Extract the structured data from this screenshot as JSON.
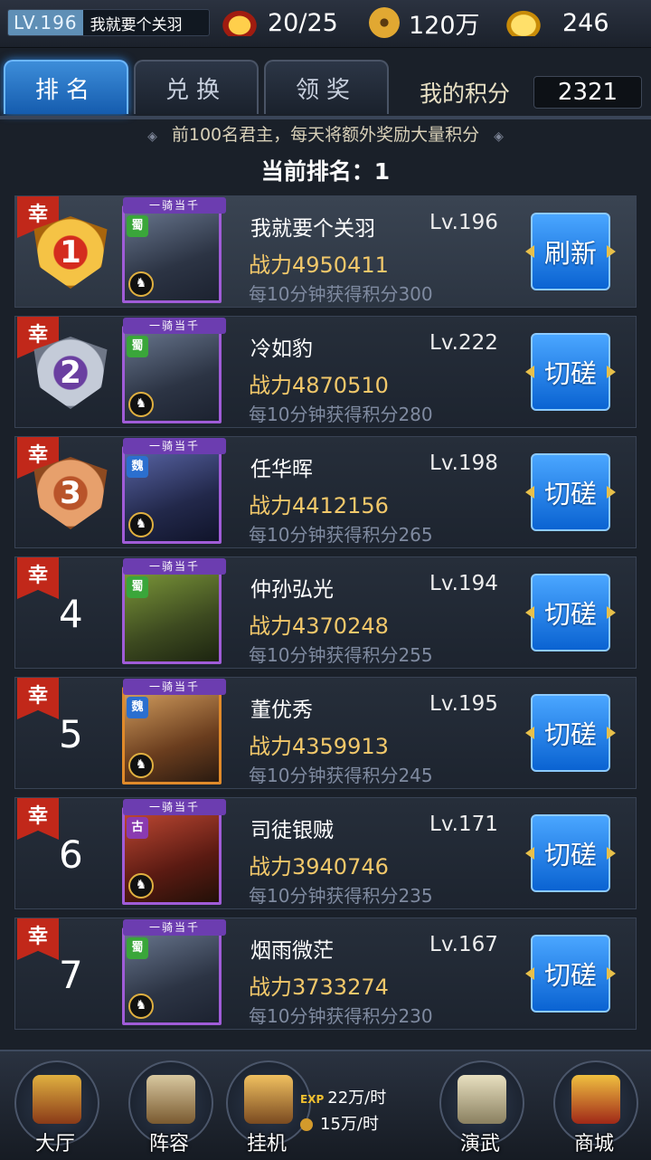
{
  "header": {
    "level_label": "LV.196",
    "player_name": "我就要个关羽",
    "stamina": "20/25",
    "copper": "120万",
    "gold": "246"
  },
  "tabs": [
    {
      "label": "排名",
      "active": true
    },
    {
      "label": "兑换",
      "active": false
    },
    {
      "label": "领奖",
      "active": false
    }
  ],
  "my_score": {
    "label": "我的积分",
    "value": "2321"
  },
  "notice": "前100名君主，每天将额外奖励大量积分",
  "current_rank": "当前排名：1",
  "rows": [
    {
      "rank": "1",
      "ribbon": "幸",
      "name": "我就要个关羽",
      "level": "Lv.196",
      "power": "战力4950411",
      "rate": "每10分钟获得积分300",
      "button": "刷新",
      "faction": "蜀",
      "tag": "一骑当千",
      "chess": "♞"
    },
    {
      "rank": "2",
      "ribbon": "幸",
      "name": "冷如豹",
      "level": "Lv.222",
      "power": "战力4870510",
      "rate": "每10分钟获得积分280",
      "button": "切磋",
      "faction": "蜀",
      "tag": "一骑当千",
      "chess": "♞"
    },
    {
      "rank": "3",
      "ribbon": "幸",
      "name": "任华晖",
      "level": "Lv.198",
      "power": "战力4412156",
      "rate": "每10分钟获得积分265",
      "button": "切磋",
      "faction": "魏",
      "tag": "一骑当千",
      "chess": "♞"
    },
    {
      "rank": "4",
      "ribbon": "幸",
      "name": "仲孙弘光",
      "level": "Lv.194",
      "power": "战力4370248",
      "rate": "每10分钟获得积分255",
      "button": "切磋",
      "faction": "蜀",
      "tag": "一骑当千",
      "chess": ""
    },
    {
      "rank": "5",
      "ribbon": "幸",
      "name": "董优秀",
      "level": "Lv.195",
      "power": "战力4359913",
      "rate": "每10分钟获得积分245",
      "button": "切磋",
      "faction": "魏",
      "tag": "一骑当千",
      "chess": "♞"
    },
    {
      "rank": "6",
      "ribbon": "幸",
      "name": "司徒银贼",
      "level": "Lv.171",
      "power": "战力3940746",
      "rate": "每10分钟获得积分235",
      "button": "切磋",
      "faction": "古",
      "tag": "一骑当千",
      "chess": "♞"
    },
    {
      "rank": "7",
      "ribbon": "幸",
      "name": "烟雨微茫",
      "level": "Lv.167",
      "power": "战力3733274",
      "rate": "每10分钟获得积分230",
      "button": "切磋",
      "faction": "蜀",
      "tag": "一骑当千",
      "chess": "♞"
    }
  ],
  "nav": [
    {
      "label": "大厅",
      "icon": "palace-icon"
    },
    {
      "label": "阵容",
      "icon": "formation-icon"
    },
    {
      "label": "挂机",
      "icon": "hourglass-icon"
    },
    {
      "label": "演武",
      "icon": "crossed-swords-icon"
    },
    {
      "label": "商城",
      "icon": "treasure-chest-icon"
    }
  ],
  "idle": {
    "exp_tag": "EXP",
    "exp_rate": "22万/时",
    "coin_rate": "15万/时"
  },
  "colors": {
    "accent_blue": "#1f7ae0",
    "ribbon_red": "#c1281a",
    "power_gold": "#f2c86a"
  }
}
